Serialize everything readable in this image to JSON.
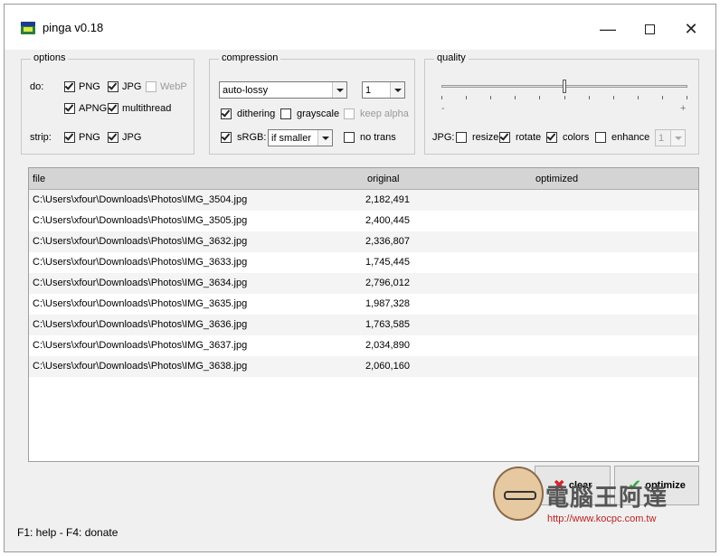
{
  "window": {
    "title": "pinga v0.18",
    "min_icon": "minimize-icon",
    "max_icon": "maximize-icon",
    "close_icon": "close-icon"
  },
  "options": {
    "title": "options",
    "do_label": "do:",
    "strip_label": "strip:",
    "png": {
      "label": "PNG",
      "checked": true
    },
    "jpg": {
      "label": "JPG",
      "checked": true
    },
    "webp": {
      "label": "WebP",
      "checked": false,
      "disabled": true
    },
    "apng": {
      "label": "APNG",
      "checked": true
    },
    "multithread": {
      "label": "multithread",
      "checked": true
    },
    "strip_png": {
      "label": "PNG",
      "checked": true
    },
    "strip_jpg": {
      "label": "JPG",
      "checked": true
    }
  },
  "compression": {
    "title": "compression",
    "mode": "auto-lossy",
    "level": "1",
    "dithering": {
      "label": "dithering",
      "checked": true
    },
    "grayscale": {
      "label": "grayscale",
      "checked": false
    },
    "keep_alpha": {
      "label": "keep alpha",
      "checked": false,
      "disabled": true
    },
    "srgb": {
      "label": "sRGB:",
      "checked": true
    },
    "srgb_mode": "if smaller",
    "no_trans": {
      "label": "no trans",
      "checked": false
    }
  },
  "quality": {
    "title": "quality",
    "minus": "-",
    "plus": "+",
    "level": 0.5,
    "jpg_label": "JPG:",
    "resize": {
      "label": "resize",
      "checked": false
    },
    "rotate": {
      "label": "rotate",
      "checked": true
    },
    "colors": {
      "label": "colors",
      "checked": true
    },
    "enhance": {
      "label": "enhance",
      "checked": false
    },
    "enhance_level": "1"
  },
  "files": {
    "columns": [
      "file",
      "original",
      "optimized"
    ],
    "rows": [
      {
        "file": "C:\\Users\\xfour\\Downloads\\Photos\\IMG_3504.jpg",
        "original": "2,182,491",
        "optimized": ""
      },
      {
        "file": "C:\\Users\\xfour\\Downloads\\Photos\\IMG_3505.jpg",
        "original": "2,400,445",
        "optimized": ""
      },
      {
        "file": "C:\\Users\\xfour\\Downloads\\Photos\\IMG_3632.jpg",
        "original": "2,336,807",
        "optimized": ""
      },
      {
        "file": "C:\\Users\\xfour\\Downloads\\Photos\\IMG_3633.jpg",
        "original": "1,745,445",
        "optimized": ""
      },
      {
        "file": "C:\\Users\\xfour\\Downloads\\Photos\\IMG_3634.jpg",
        "original": "2,796,012",
        "optimized": ""
      },
      {
        "file": "C:\\Users\\xfour\\Downloads\\Photos\\IMG_3635.jpg",
        "original": "1,987,328",
        "optimized": ""
      },
      {
        "file": "C:\\Users\\xfour\\Downloads\\Photos\\IMG_3636.jpg",
        "original": "1,763,585",
        "optimized": ""
      },
      {
        "file": "C:\\Users\\xfour\\Downloads\\Photos\\IMG_3637.jpg",
        "original": "2,034,890",
        "optimized": ""
      },
      {
        "file": "C:\\Users\\xfour\\Downloads\\Photos\\IMG_3638.jpg",
        "original": "2,060,160",
        "optimized": ""
      }
    ]
  },
  "actions": {
    "clear_label": "clear",
    "clear_icon": "x-icon",
    "optimize_label": "optimize",
    "optimize_icon": "checkmark-icon"
  },
  "status": {
    "text": "F1: help - F4: donate"
  },
  "watermark": {
    "title": "電腦王阿達",
    "url": "http://www.kocpc.com.tw"
  },
  "colors": {
    "clear_icon": "#d8222a",
    "optimize_icon": "#3aa845",
    "header_bg": "#d4d4d4"
  }
}
